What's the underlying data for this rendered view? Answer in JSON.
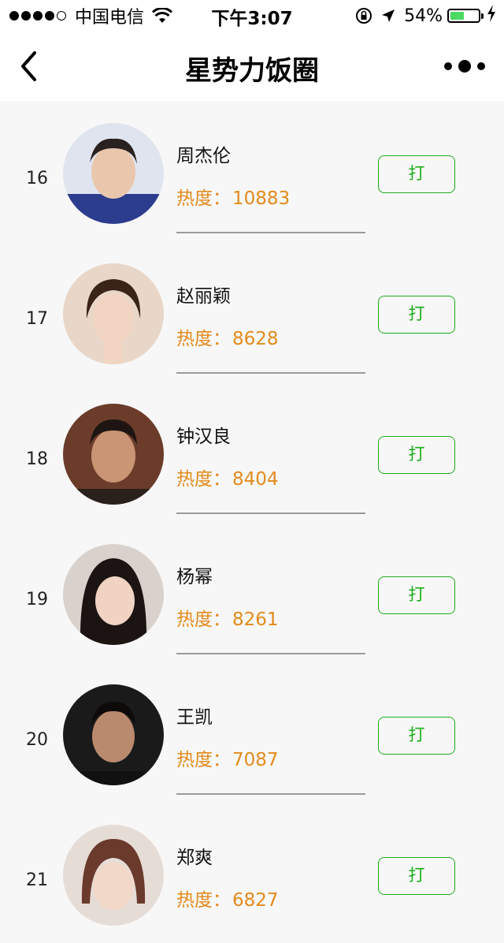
{
  "status_bar": {
    "carrier": "中国电信",
    "time": "下午3:07",
    "battery_percent": "54%",
    "battery_level": 0.54,
    "battery_color": "#4cd964"
  },
  "nav": {
    "title": "星势力饭圈",
    "back_icon": "chevron-left-icon",
    "more_icon": "more-dots-icon"
  },
  "colors": {
    "heat": "#e38a1c",
    "button": "#1aad19",
    "background": "#f7f7f7"
  },
  "heat_label": "热度：",
  "list": [
    {
      "rank": "16",
      "name": "周杰伦",
      "heat": "10883",
      "button": "打"
    },
    {
      "rank": "17",
      "name": "赵丽颖",
      "heat": "8628",
      "button": "打"
    },
    {
      "rank": "18",
      "name": "钟汉良",
      "heat": "8404",
      "button": "打"
    },
    {
      "rank": "19",
      "name": "杨幂",
      "heat": "8261",
      "button": "打"
    },
    {
      "rank": "20",
      "name": "王凯",
      "heat": "7087",
      "button": "打"
    },
    {
      "rank": "21",
      "name": "郑爽",
      "heat": "6827",
      "button": "打"
    }
  ]
}
